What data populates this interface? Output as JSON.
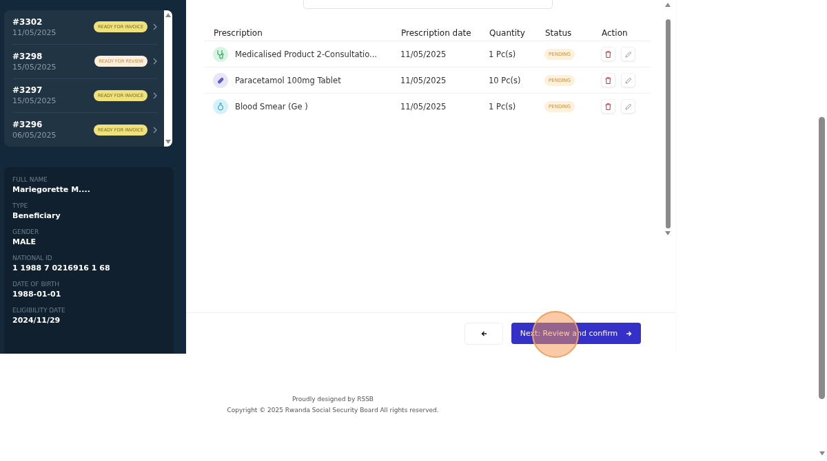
{
  "recent_visits": [
    {
      "number": "#3302",
      "date": "11/05/2025",
      "status": "READY FOR INVOICE",
      "kind": "invoice"
    },
    {
      "number": "#3298",
      "date": "15/05/2025",
      "status": "READY FOR REVIEW",
      "kind": "review"
    },
    {
      "number": "#3297",
      "date": "15/05/2025",
      "status": "READY FOR INVOICE",
      "kind": "invoice"
    },
    {
      "number": "#3296",
      "date": "06/05/2025",
      "status": "READY FOR INVOICE",
      "kind": "invoice"
    }
  ],
  "patient": [
    {
      "label": "FULL NAME",
      "value": "Mariegorette M...."
    },
    {
      "label": "TYPE",
      "value": "Beneficiary"
    },
    {
      "label": "GENDER",
      "value": "MALE"
    },
    {
      "label": "NATIONAL ID",
      "value": "1 1988 7 0216916 1 68"
    },
    {
      "label": "DATE OF BIRTH",
      "value": "1988-01-01"
    },
    {
      "label": "ELIGIBILITY DATE",
      "value": "2024/11/29"
    }
  ],
  "table": {
    "columns": [
      "Prescription",
      "Prescription date",
      "Quantity",
      "Status",
      "Action"
    ],
    "rows": [
      {
        "kind": "consultation",
        "prescription": "Medicalised Product 2-Consultatio...",
        "date": "11/05/2025",
        "quantity": "1 Pc(s)",
        "status": "PENDING"
      },
      {
        "kind": "medicine",
        "prescription": "Paracetamol 100mg Tablet",
        "date": "11/05/2025",
        "quantity": "10 Pc(s)",
        "status": "PENDING"
      },
      {
        "kind": "lab",
        "prescription": "Blood Smear (Ge )",
        "date": "11/05/2025",
        "quantity": "1 Pc(s)",
        "status": "PENDING"
      }
    ]
  },
  "next_button": {
    "label": "Next: Review and confirm"
  },
  "footer": {
    "credit": "Proudly designed by RSSB",
    "copyright": "Copyright © 2025 Rwanda Social Security Board All rights reserved."
  }
}
